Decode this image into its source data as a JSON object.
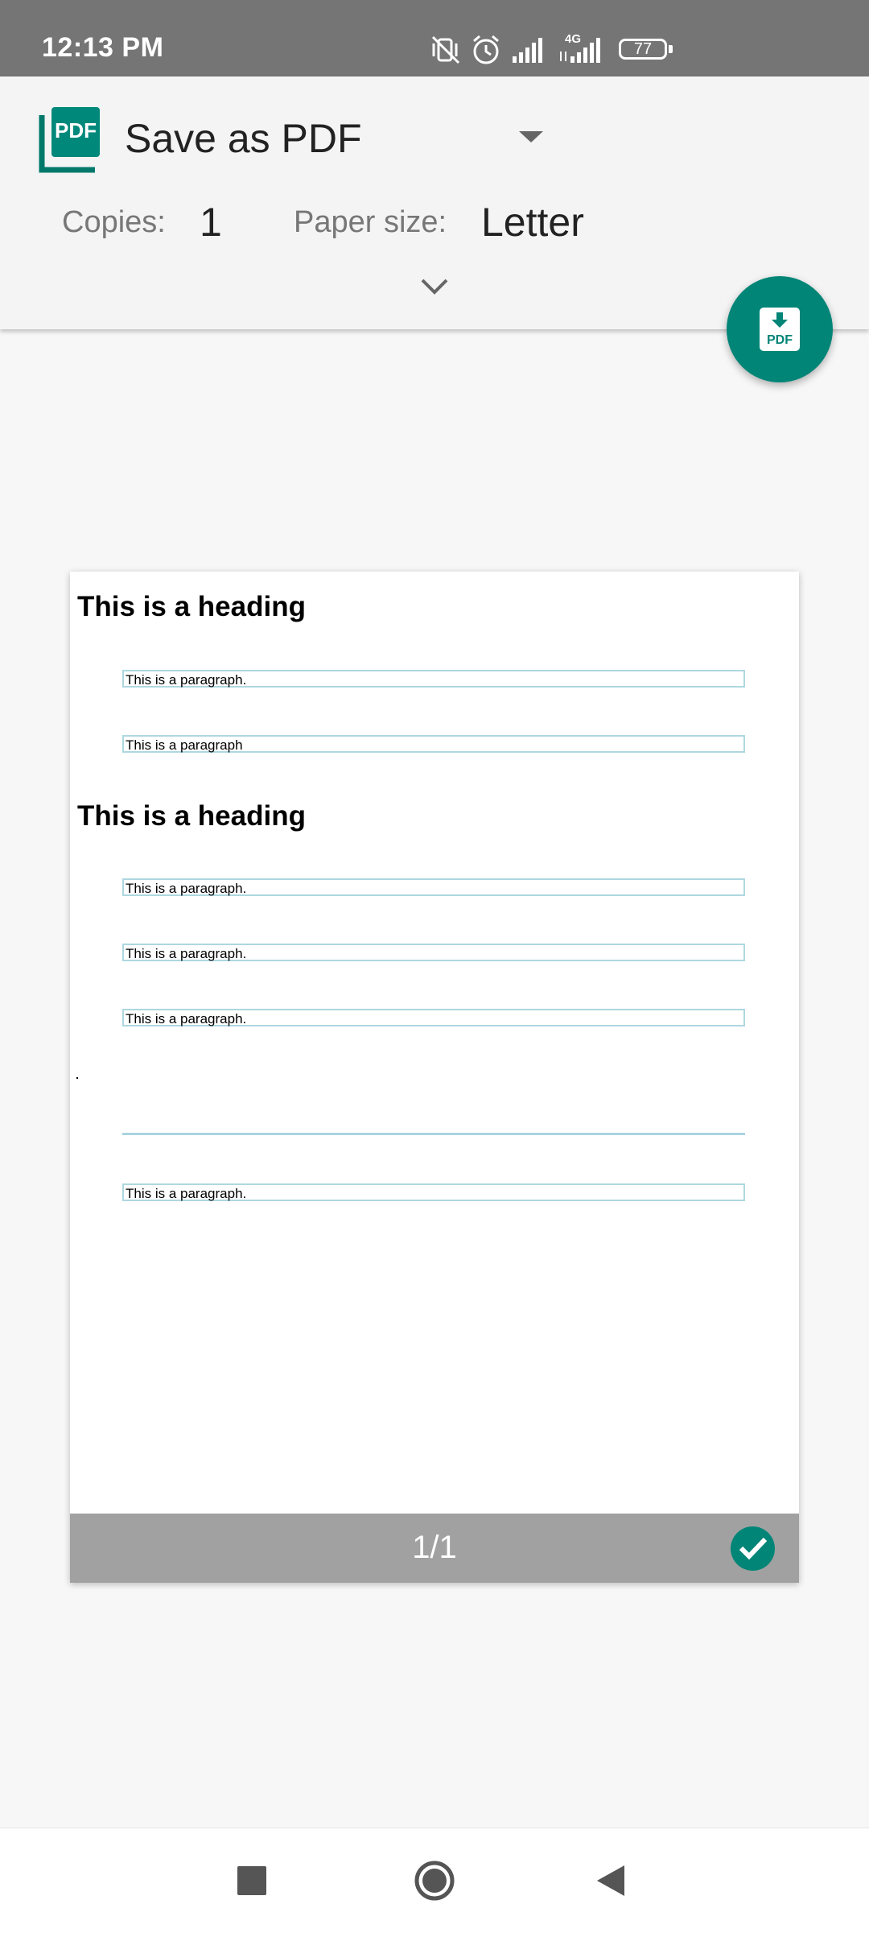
{
  "status_bar": {
    "time": "12:13 PM",
    "network": "4G",
    "battery": "77"
  },
  "print_options": {
    "printer_name": "Save as PDF",
    "copies_label": "Copies:",
    "copies_value": "1",
    "paper_size_label": "Paper size:",
    "paper_size_value": "Letter",
    "printer_icon_text": "PDF",
    "fab_icon_text": "PDF"
  },
  "preview": {
    "headings": [
      "This is a heading",
      "This is a heading"
    ],
    "paragraphs": [
      "This is a paragraph.",
      "This is a paragraph",
      "This is a paragraph.",
      "This is a paragraph.",
      "This is a paragraph.",
      "This is a paragraph."
    ],
    "page_indicator": "1/1"
  },
  "colors": {
    "accent": "#008577",
    "status_bar": "#757575",
    "page_bar": "#a1a1a1"
  }
}
